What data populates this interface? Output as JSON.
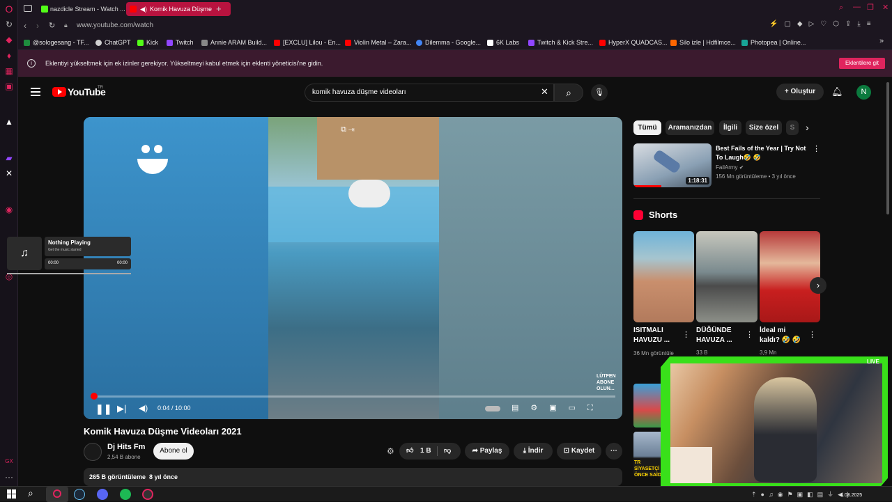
{
  "browser": {
    "tabs": [
      {
        "label": "nazdicle Stream - Watch ..."
      },
      {
        "label": "Komik Havuza Düşme"
      }
    ],
    "url": "www.youtube.com/watch",
    "bookmarks": [
      {
        "label": "@sologesang - TF...",
        "color": "#1e8e3e"
      },
      {
        "label": "ChatGPT",
        "color": "#cfcfcf"
      },
      {
        "label": "Kick",
        "color": "#53fc18"
      },
      {
        "label": "Twitch",
        "color": "#9146ff"
      },
      {
        "label": "Annie ARAM Build...",
        "color": "#888888"
      },
      {
        "label": "[EXCLU] Lilou - En...",
        "color": "#ff0000"
      },
      {
        "label": "Violin Metal – Zara...",
        "color": "#ff0000"
      },
      {
        "label": "Dilemma - Google...",
        "color": "#4285f4"
      },
      {
        "label": "6K Labs",
        "color": "#ffffff"
      },
      {
        "label": "Twitch & Kick Stre...",
        "color": "#9146ff"
      },
      {
        "label": "HyperX QUADCAS...",
        "color": "#ff0000"
      },
      {
        "label": "Silo izle | Hdfilmce...",
        "color": "#ff6600"
      },
      {
        "label": "Photopea | Online...",
        "color": "#18a497"
      }
    ]
  },
  "warning": {
    "text": "Eklentiyi yükseltmek için ek izinler gerekiyor. Yükseltmeyi kabul etmek için eklenti yöneticisi'ne gidin.",
    "button": "Eklentilere git"
  },
  "youtube": {
    "logo": "YouTube",
    "region": "TR",
    "search_value": "komik havuza düşme videoları",
    "create_label": "Oluştur",
    "avatar_letter": "N",
    "chips": [
      "Tümü",
      "Aramanızdan",
      "İlgili",
      "Size özel",
      "S"
    ],
    "player": {
      "time": "0:04 / 10:00",
      "progress": 0.007,
      "watermark": "LÜTFEN ABONE OLUN..."
    },
    "video": {
      "title": "Komik Havuza Düşme Videoları 2021",
      "channel": "Dj Hits Fm",
      "subscribers": "2,54 B abone",
      "subscribe_label": "Abone ol",
      "likes": "1 B",
      "share_label": "Paylaş",
      "download_label": "İndir",
      "save_label": "Kaydet",
      "views_line": "265 B görüntüleme  8 yıl önce"
    },
    "recommended": {
      "title": "Best Fails of the Year | Try Not To Laugh🤣 🤣",
      "channel": "FailArmy",
      "meta": "156 Mn görüntüleme • 3 yıl önce",
      "duration": "1:18:31"
    },
    "shorts_title": "Shorts",
    "shorts": [
      {
        "title": "ISITMALI HAVUZU ...",
        "meta": "36 Mn görüntüle"
      },
      {
        "title": "DÜĞÜNDE HAVUZA ...",
        "meta": "33 B"
      },
      {
        "title": "İdeal mi kaldı? 🤣 🤣",
        "meta": "3,9 Mn"
      }
    ],
    "side_thumb_text": "TR SİYASETÇİ ÖNCE SAİD"
  },
  "music_widget": {
    "title": "Nothing Playing",
    "subtitle": "Get the music started",
    "time_start": "00:00",
    "time_end": "00:00"
  },
  "stream_overlay": {
    "badge": "LIVE"
  },
  "taskbar": {
    "date": "4.08.2025"
  }
}
